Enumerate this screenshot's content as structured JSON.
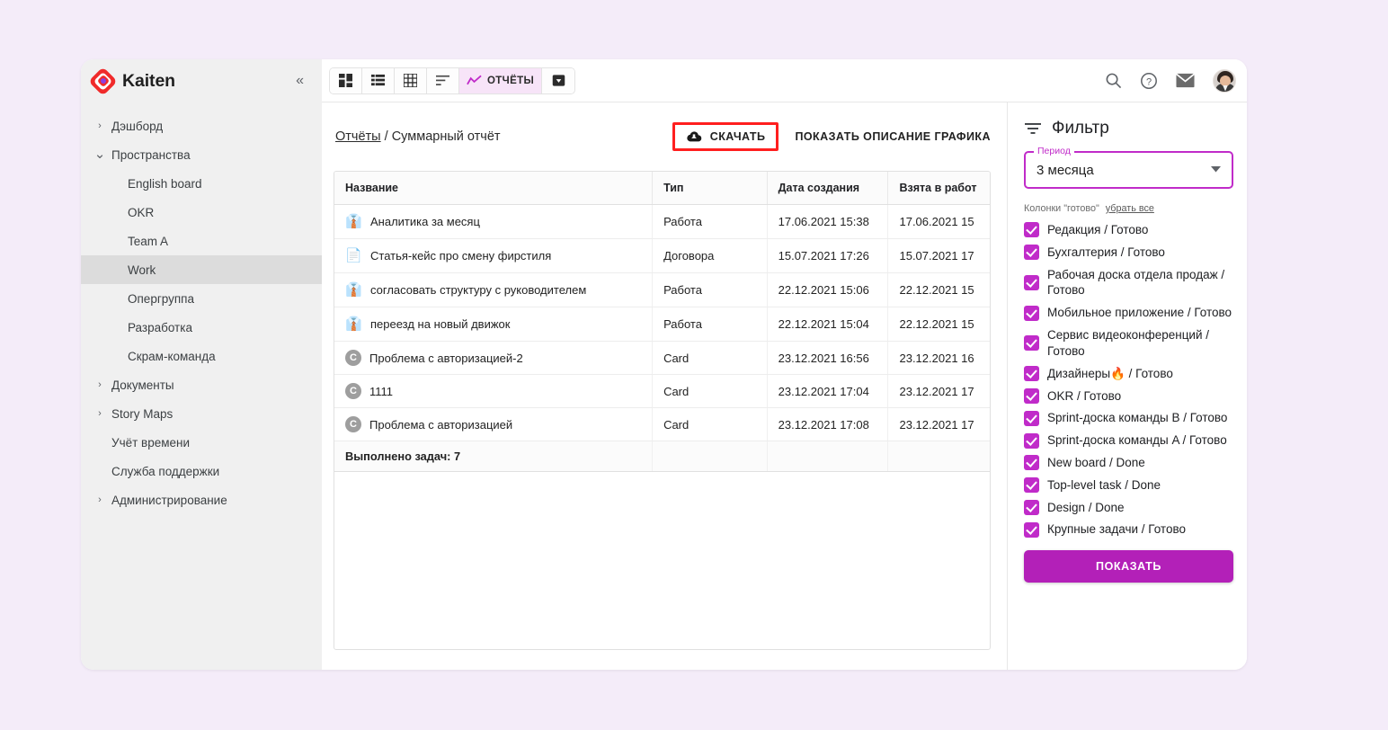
{
  "brand": {
    "name": "Kaiten",
    "logo_icon": "kaiten-logo-icon"
  },
  "sidebar": {
    "collapse_icon": "«",
    "items": [
      {
        "label": "Дэшборд",
        "depth": 0,
        "caret": "›",
        "active": false
      },
      {
        "label": "Пространства",
        "depth": 0,
        "caret": "⌄",
        "active": false
      },
      {
        "label": "English board",
        "depth": 1,
        "caret": "",
        "active": false
      },
      {
        "label": "OKR",
        "depth": 1,
        "caret": "",
        "active": false
      },
      {
        "label": "Team A",
        "depth": 1,
        "caret": "",
        "active": false
      },
      {
        "label": "Work",
        "depth": 1,
        "caret": "",
        "active": true
      },
      {
        "label": "Опергруппа",
        "depth": 1,
        "caret": "",
        "active": false
      },
      {
        "label": "Разработка",
        "depth": 1,
        "caret": "",
        "active": false
      },
      {
        "label": "Скрам-команда",
        "depth": 1,
        "caret": "",
        "active": false
      },
      {
        "label": "Документы",
        "depth": 0,
        "caret": "›",
        "active": false
      },
      {
        "label": "Story Maps",
        "depth": 0,
        "caret": "›",
        "active": false
      },
      {
        "label": "Учёт времени",
        "depth": 0,
        "caret": "",
        "active": false
      },
      {
        "label": "Служба поддержки",
        "depth": 0,
        "caret": "",
        "active": false
      },
      {
        "label": "Администрирование",
        "depth": 0,
        "caret": "›",
        "active": false
      }
    ]
  },
  "toolbar": {
    "views": [
      {
        "name": "board-view",
        "icon": "board-icon",
        "label": "",
        "active": false
      },
      {
        "name": "list-view",
        "icon": "list-icon",
        "label": "",
        "active": false
      },
      {
        "name": "grid-view",
        "icon": "grid-icon",
        "label": "",
        "active": false
      },
      {
        "name": "sorted-view",
        "icon": "sort-lines-icon",
        "label": "",
        "active": false
      },
      {
        "name": "reports-view",
        "icon": "chart-line-icon",
        "label": "ОТЧЁТЫ",
        "active": true
      },
      {
        "name": "archive-view",
        "icon": "archive-box-icon",
        "label": "",
        "active": false
      }
    ],
    "right_icons": [
      {
        "name": "search-icon"
      },
      {
        "name": "help-icon"
      },
      {
        "name": "mail-icon"
      },
      {
        "name": "avatar"
      }
    ]
  },
  "report": {
    "breadcrumb_link": "Отчёты",
    "breadcrumb_sep": " / ",
    "breadcrumb_current": "Суммарный отчёт",
    "download_label": "СКАЧАТЬ",
    "download_icon": "cloud-download-icon",
    "description_label": "ПОКАЗАТЬ ОПИСАНИЕ ГРАФИКА",
    "highlight_color": "#ff1f1f",
    "columns": [
      "Название",
      "Тип",
      "Дата создания",
      "Взята в работ"
    ],
    "rows": [
      {
        "icon": "person-card-icon",
        "icon_glyph": "👔",
        "name": "Аналитика за месяц",
        "type": "Работа",
        "created": "17.06.2021 15:38",
        "started": "17.06.2021 15"
      },
      {
        "icon": "document-card-icon",
        "icon_glyph": "📄",
        "name": "Статья-кейс про смену фирстиля",
        "type": "Договора",
        "created": "15.07.2021 17:26",
        "started": "15.07.2021 17"
      },
      {
        "icon": "person-card-icon",
        "icon_glyph": "👔",
        "name": "согласовать структуру с руководителем",
        "type": "Работа",
        "created": "22.12.2021 15:06",
        "started": "22.12.2021 15"
      },
      {
        "icon": "person-card-icon",
        "icon_glyph": "👔",
        "name": "переезд на новый движок",
        "type": "Работа",
        "created": "22.12.2021 15:04",
        "started": "22.12.2021 15"
      },
      {
        "icon": "card-letter-icon",
        "icon_glyph": "C",
        "name": "Проблема с авторизацией-2",
        "type": "Card",
        "created": "23.12.2021 16:56",
        "started": "23.12.2021 16"
      },
      {
        "icon": "card-letter-icon",
        "icon_glyph": "C",
        "name": "1111",
        "type": "Card",
        "created": "23.12.2021 17:04",
        "started": "23.12.2021 17"
      },
      {
        "icon": "card-letter-icon",
        "icon_glyph": "C",
        "name": "Проблема с авторизацией",
        "type": "Card",
        "created": "23.12.2021 17:08",
        "started": "23.12.2021 17"
      }
    ],
    "total_label": "Выполнено задач: 7"
  },
  "filter": {
    "title": "Фильтр",
    "icon": "filter-icon",
    "period_legend": "Период",
    "period_value": "3 месяца",
    "period_options": [
      "3 месяца"
    ],
    "columns_label": "Колонки \"готово\"",
    "clear_all_label": "убрать все",
    "accent_color": "#c02bc9",
    "checkboxes": [
      {
        "label": "Редакция / Готово",
        "checked": true
      },
      {
        "label": "Бухгалтерия / Готово",
        "checked": true
      },
      {
        "label": "Рабочая доска отдела продаж / Готово",
        "checked": true
      },
      {
        "label": "Мобильное приложение / Готово",
        "checked": true
      },
      {
        "label": "Сервис видеоконференций / Готово",
        "checked": true
      },
      {
        "label": "Дизайнеры🔥 / Готово",
        "checked": true
      },
      {
        "label": "OKR / Готово",
        "checked": true
      },
      {
        "label": "Sprint-доска команды B / Готово",
        "checked": true
      },
      {
        "label": "Sprint-доска команды A / Готово",
        "checked": true
      },
      {
        "label": "New board / Done",
        "checked": true
      },
      {
        "label": "Top-level task / Done",
        "checked": true
      },
      {
        "label": "Design / Done",
        "checked": true
      },
      {
        "label": "Крупные задачи / Готово",
        "checked": true
      }
    ],
    "show_button_label": "ПОКАЗАТЬ"
  }
}
